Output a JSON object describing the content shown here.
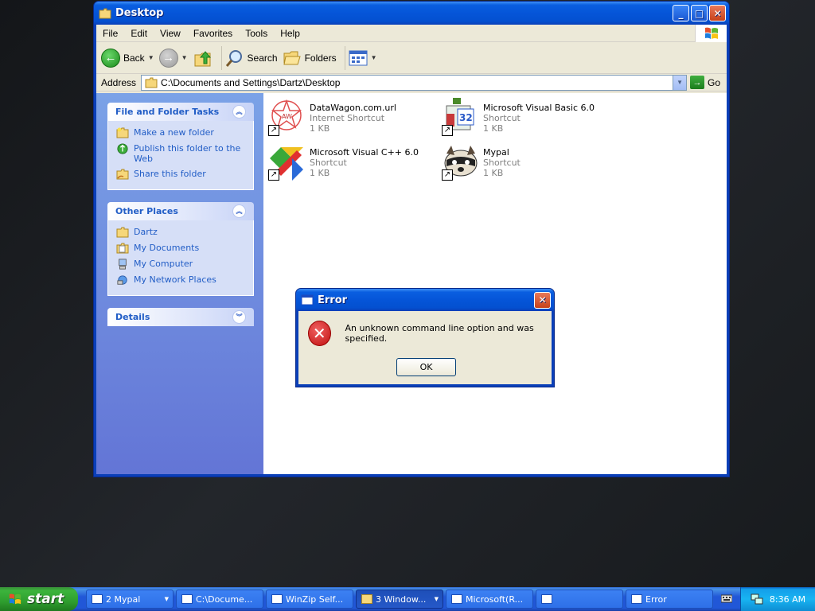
{
  "window": {
    "title": "Desktop",
    "controls": {
      "minimize": "_",
      "maximize": "□",
      "close": "✕"
    }
  },
  "menu": [
    "File",
    "Edit",
    "View",
    "Favorites",
    "Tools",
    "Help"
  ],
  "toolbar": {
    "back": "Back",
    "search": "Search",
    "folders": "Folders"
  },
  "address": {
    "label": "Address",
    "path": "C:\\Documents and Settings\\Dartz\\Desktop",
    "go": "Go"
  },
  "taskpane": {
    "file_tasks": {
      "title": "File and Folder Tasks",
      "items": [
        "Make a new folder",
        "Publish this folder to the Web",
        "Share this folder"
      ]
    },
    "other_places": {
      "title": "Other Places",
      "items": [
        "Dartz",
        "My Documents",
        "My Computer",
        "My Network Places"
      ]
    },
    "details": {
      "title": "Details"
    }
  },
  "files": [
    {
      "name": "DataWagon.com.url",
      "type": "Internet Shortcut",
      "size": "1 KB",
      "icon": "datawagon-icon"
    },
    {
      "name": "Microsoft Visual Basic 6.0",
      "type": "Shortcut",
      "size": "1 KB",
      "icon": "vb6-icon"
    },
    {
      "name": "Microsoft Visual C++ 6.0",
      "type": "Shortcut",
      "size": "1 KB",
      "icon": "vcpp6-icon"
    },
    {
      "name": "Mypal",
      "type": "Shortcut",
      "size": "1 KB",
      "icon": "mypal-icon"
    }
  ],
  "dialog": {
    "title": "Error",
    "message": "An unknown command line option and was specified.",
    "ok": "OK"
  },
  "taskbar": {
    "start": "start",
    "buttons": [
      {
        "label": "2 Mypal",
        "dropdown": true,
        "active": false
      },
      {
        "label": "C:\\Docume...",
        "dropdown": false,
        "active": false
      },
      {
        "label": "WinZip Self...",
        "dropdown": false,
        "active": false
      },
      {
        "label": "3 Window...",
        "dropdown": true,
        "active": true
      },
      {
        "label": "Microsoft(R...",
        "dropdown": false,
        "active": false
      },
      {
        "label": "",
        "dropdown": false,
        "active": false
      },
      {
        "label": "Error",
        "dropdown": false,
        "active": false
      }
    ],
    "clock": "8:36 AM"
  }
}
